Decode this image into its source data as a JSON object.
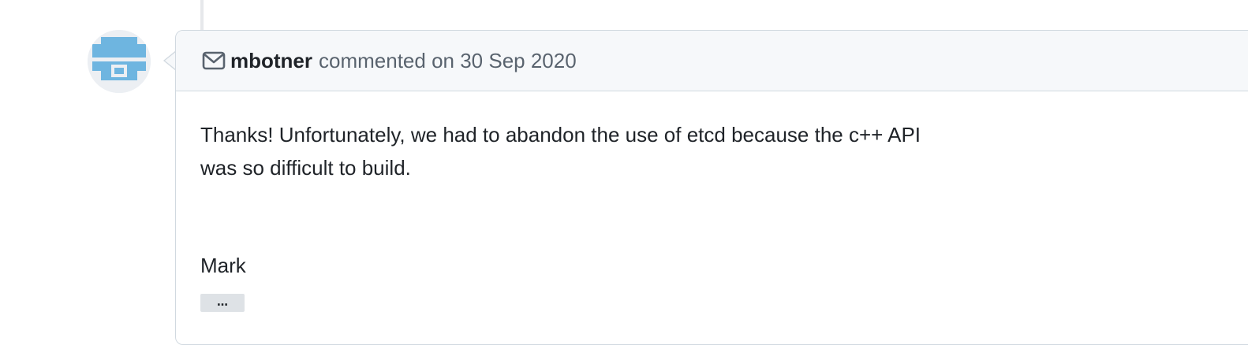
{
  "comment": {
    "author": "mbotner",
    "meta": "commented on 30 Sep 2020",
    "header_icon": "mail-icon",
    "avatar_icon": "identicon-avatar",
    "body_text": "Thanks!  Unfortunately, we had to abandon the use of etcd because the c++ API was so difficult to build.",
    "signature": "Mark",
    "expand_label": "…"
  },
  "colors": {
    "avatar_accent": "#6eb5e0",
    "header_bg": "#f6f8fa",
    "border": "#d1d9e0"
  }
}
